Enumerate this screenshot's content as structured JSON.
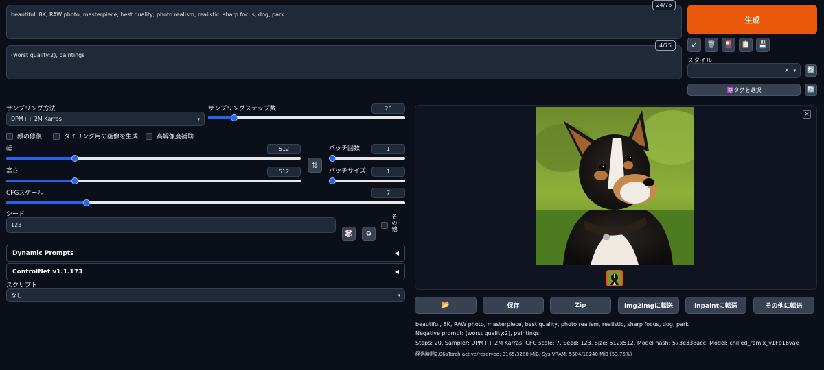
{
  "prompt": {
    "value": "beautiful, 8K, RAW photo, masterpiece, best quality, photo realism, realistic, sharp focus, dog, park",
    "counter": "24/75"
  },
  "negative_prompt": {
    "value": "(worst quality:2), paintings",
    "counter": "4/75"
  },
  "generate_label": "生成",
  "tools": {
    "arrow": "↙",
    "trash": "🗑",
    "art": "🎴",
    "clipboard": "📋",
    "save": "💾"
  },
  "style": {
    "label": "スタイル",
    "clear": "×",
    "caret": "▾",
    "refresh": "🔄"
  },
  "tag_select": {
    "label": "🔯タグを選択",
    "refresh": "🔄"
  },
  "sampling": {
    "method_label": "サンプリング方法",
    "method_value": "DPM++ 2M Karras",
    "steps_label": "サンプリングステップ数",
    "steps_value": "20",
    "steps_fraction": 0.13
  },
  "checkboxes": {
    "restore_faces": "顔の修復",
    "tiling": "タイリング用の画像を生成",
    "hires_fix": "高解像度補助"
  },
  "width": {
    "label": "幅",
    "value": "512",
    "fraction": 0.23
  },
  "height": {
    "label": "高さ",
    "value": "512",
    "fraction": 0.23
  },
  "swap_icon": "⇅",
  "batch_count": {
    "label": "バッチ回数",
    "value": "1",
    "fraction": 0
  },
  "batch_size": {
    "label": "バッチサイズ",
    "value": "1",
    "fraction": 0
  },
  "cfg": {
    "label": "CFGスケール",
    "value": "7",
    "fraction": 0.2
  },
  "seed": {
    "label": "シード",
    "value": "123",
    "dice": "🎲",
    "recycle": "♻",
    "extra_label": "その他"
  },
  "dynamic_prompts": {
    "label": "Dynamic Prompts",
    "caret": "◀"
  },
  "controlnet": {
    "label": "ControlNet v1.1.173",
    "caret": "◀"
  },
  "script": {
    "label": "スクリプト",
    "value": "なし",
    "caret": "▾"
  },
  "gallery": {
    "close": "×"
  },
  "output_buttons": {
    "folder": "📂",
    "save": "保存",
    "zip": "Zip",
    "img2img": "img2imgに転送",
    "inpaint": "inpaintに転送",
    "extras": "その他に転送"
  },
  "info": {
    "prompt": "beautiful, 8K, RAW photo, masterpiece, best quality, photo realism, realistic, sharp focus, dog, park",
    "negative": "Negative prompt: (worst quality:2), paintings",
    "params": "Steps: 20, Sampler: DPM++ 2M Karras, CFG scale: 7, Seed: 123, Size: 512x512, Model hash: 573e338acc, Model: chilled_remix_v1Fp16vae",
    "timing": "経過時間2.06sTorch active/reserved: 3165/3280 MiB, Sys VRAM: 5504/10240 MiB (53.75%)"
  },
  "colors": {
    "accent": "#ea580c",
    "slider": "#2563eb",
    "background": "#0b0f19"
  }
}
